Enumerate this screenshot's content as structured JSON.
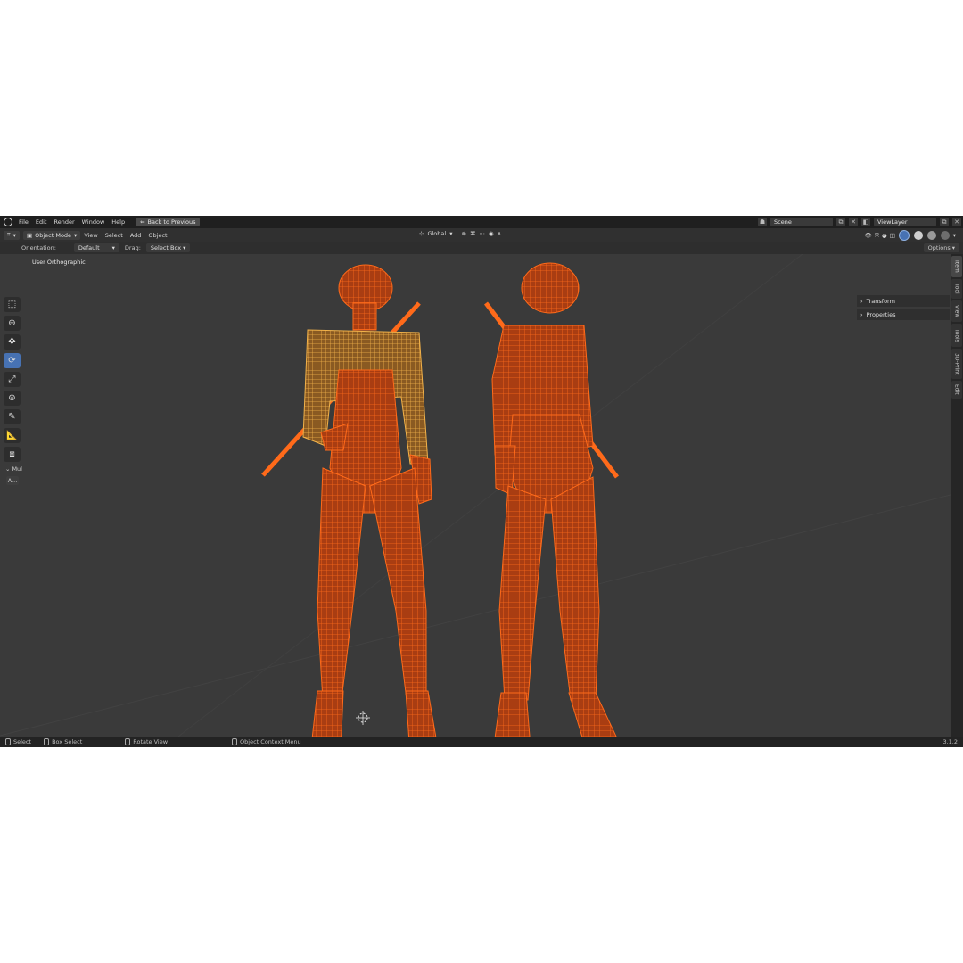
{
  "menu": {
    "items": [
      "File",
      "Edit",
      "Render",
      "Window",
      "Help"
    ],
    "back_button": "Back to Previous",
    "scene": "Scene",
    "view_layer": "ViewLayer"
  },
  "header": {
    "mode": "Object Mode",
    "menus": [
      "View",
      "Select",
      "Add",
      "Object"
    ],
    "orientation_global": "Global"
  },
  "tool_settings": {
    "orientation_label": "Orientation:",
    "orientation_value": "Default",
    "drag_label": "Drag:",
    "drag_value": "Select Box",
    "options": "Options"
  },
  "viewport": {
    "label": "User Orthographic",
    "operator_panel": "Mul",
    "operator_button": "A..."
  },
  "npanel": {
    "sections": [
      "Transform",
      "Properties"
    ]
  },
  "side_tabs": [
    "Item",
    "Tool",
    "View",
    "Tools",
    "3D-Print",
    "Edit"
  ],
  "status": {
    "select": "Select",
    "box_select": "Box Select",
    "rotate_view": "Rotate View",
    "context_menu": "Object Context Menu",
    "version": "3.1.2"
  },
  "colors": {
    "wire": "#ff6a1a",
    "jacket": "#f2b24a",
    "active_tool": "#4772b3"
  }
}
